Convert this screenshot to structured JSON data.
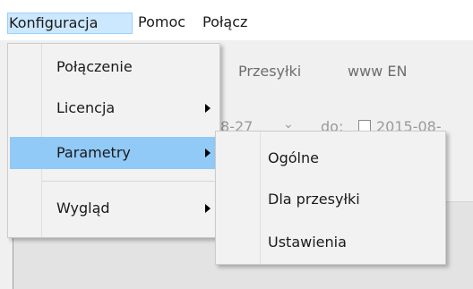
{
  "menubar": {
    "items": [
      {
        "label": "Konfiguracja",
        "active": true
      },
      {
        "label": "Pomoc"
      },
      {
        "label": "Połącz"
      }
    ]
  },
  "background": {
    "tabs": [
      "Przesyłki",
      "www EN"
    ],
    "date_from": "8-27",
    "do_label": "do:",
    "date_to": "2015-08-"
  },
  "main_menu": {
    "items": [
      {
        "label": "Połączenie",
        "submenu": false
      },
      {
        "label": "Licencja",
        "submenu": true
      },
      {
        "label": "Parametry",
        "submenu": true,
        "highlighted": true
      },
      {
        "label": "Wygląd",
        "submenu": true
      }
    ]
  },
  "sub_menu": {
    "items": [
      {
        "label": "Ogólne"
      },
      {
        "label": "Dla przesyłki"
      },
      {
        "label": "Ustawienia"
      }
    ]
  },
  "colors": {
    "highlight": "#91c9f7",
    "menubar_active": "#cce8ff"
  }
}
